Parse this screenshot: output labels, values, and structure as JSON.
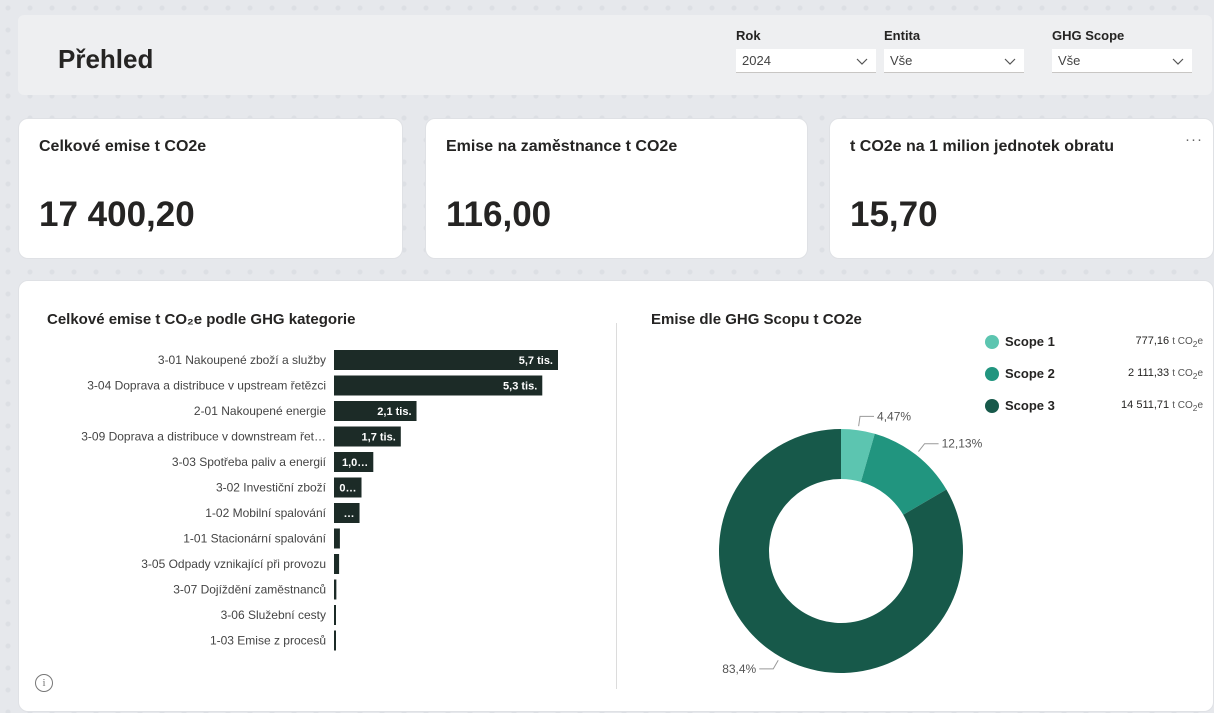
{
  "header": {
    "title": "Přehled"
  },
  "filters": [
    {
      "label": "Rok",
      "value": "2024"
    },
    {
      "label": "Entita",
      "value": "Vše"
    },
    {
      "label": "GHG Scope",
      "value": "Vše"
    }
  ],
  "kpis": [
    {
      "title": "Celkové emise t CO2e",
      "value": "17 400,20"
    },
    {
      "title": "Emise na zaměstnance t CO2e",
      "value": "116,00"
    },
    {
      "title": "t CO2e na 1 milion jednotek obratu",
      "value": "15,70",
      "more": "···"
    }
  ],
  "info_icon": "i",
  "chart_data": [
    {
      "type": "bar",
      "orientation": "horizontal",
      "title": "Celkové emise t CO₂e podle GHG kategorie",
      "color": "#1c2b27",
      "categories": [
        "3-01 Nakoupené zboží a služby",
        "3-04 Doprava a distribuce v upstream řetězci",
        "2-01 Nakoupené energie",
        "3-09 Doprava a distribuce v downstream řet…",
        "3-03 Spotřeba paliv a energií",
        "3-02 Investiční zboží",
        "1-02 Mobilní spalování",
        "1-01 Stacionární spalování",
        "3-05 Odpady vznikající při provozu",
        "3-07 Dojíždění zaměstnanců",
        "3-06 Služební cesty",
        "1-03 Emise z procesů"
      ],
      "values": [
        5700,
        5300,
        2100,
        1700,
        1000,
        700,
        650,
        150,
        130,
        60,
        30,
        20
      ],
      "labels": [
        "5,7 tis.",
        "5,3 tis.",
        "2,1 tis.",
        "1,7 tis.",
        "1,0…",
        "0…",
        "…",
        "",
        "",
        "",
        "",
        ""
      ]
    },
    {
      "type": "pie",
      "donut": true,
      "title": "Emise dle GHG Scopu t CO2e",
      "series": [
        {
          "name": "Scope 1",
          "value": 777.16,
          "value_label": "777,16",
          "pct_label": "4,47%",
          "color": "#5cc5b0"
        },
        {
          "name": "Scope 2",
          "value": 2111.33,
          "value_label": "2 111,33",
          "pct_label": "12,13%",
          "color": "#21957f"
        },
        {
          "name": "Scope 3",
          "value": 14511.71,
          "value_label": "14 511,71",
          "pct_label": "83,4%",
          "color": "#17594a"
        }
      ],
      "unit": "t CO",
      "unit_sub": "2",
      "unit_suffix": "e",
      "legend_position": "top-right"
    }
  ]
}
